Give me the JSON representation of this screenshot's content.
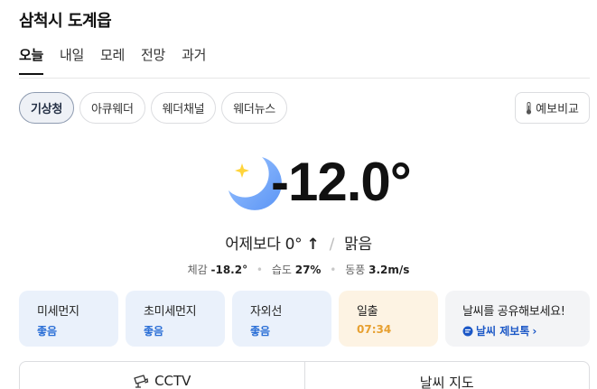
{
  "location": "삼척시 도계읍",
  "day_tabs": [
    "오늘",
    "내일",
    "모레",
    "전망",
    "과거"
  ],
  "sources": [
    "기상청",
    "아큐웨더",
    "웨더채널",
    "웨더뉴스"
  ],
  "compare_label": "예보비교",
  "current": {
    "temperature": "-12.0°",
    "icon": "moon-star-icon",
    "vs_yesterday": "어제보다 0°",
    "trend": "↑",
    "separator": "/",
    "condition": "맑음",
    "feels_label": "체감",
    "feels_value": "-18.2°",
    "humidity_label": "습도",
    "humidity_value": "27%",
    "wind_label": "동풍",
    "wind_value": "3.2m/s"
  },
  "cards": [
    {
      "label": "미세먼지",
      "value": "좋음"
    },
    {
      "label": "초미세먼지",
      "value": "좋음"
    },
    {
      "label": "자외선",
      "value": "좋음"
    },
    {
      "label": "일출",
      "value": "07:34"
    }
  ],
  "share": {
    "label": "날씨를 공유해보세요!",
    "link": "날씨 제보톡",
    "chevron": "›"
  },
  "bottom": {
    "cctv": "CCTV",
    "map": "날씨 지도"
  },
  "colors": {
    "accent_blue": "#2b6fd6",
    "sunrise_orange": "#e7a030",
    "moon_blue": "#6ea8ff",
    "star_yellow": "#ffd43b"
  }
}
